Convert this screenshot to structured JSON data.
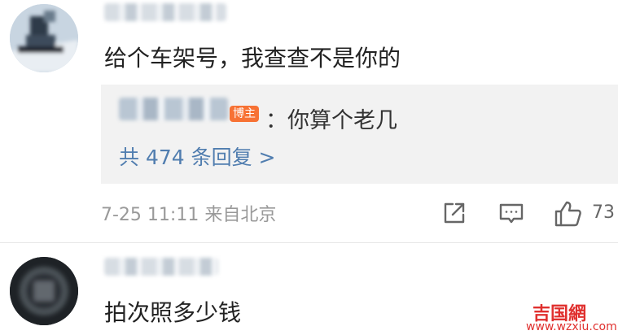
{
  "comments": [
    {
      "text": "给个车架号，我查查不是你的",
      "reply_preview": {
        "op_badge": "博主",
        "text": "：你算个老几"
      },
      "reply_count_label": "共 474 条回复 >",
      "timestamp": "7-25 11:11 来自北京",
      "like_count": "73"
    },
    {
      "text": "拍次照多少钱"
    }
  ],
  "watermark": {
    "site_name": "吉国網",
    "site_url": "www.wzxiu.com"
  },
  "icons": [
    "share-icon",
    "comment-icon",
    "like-icon"
  ],
  "colors": {
    "link": "#507daf",
    "badge": "#f77234",
    "muted": "#999999",
    "reply_bg": "#f2f2f2"
  }
}
